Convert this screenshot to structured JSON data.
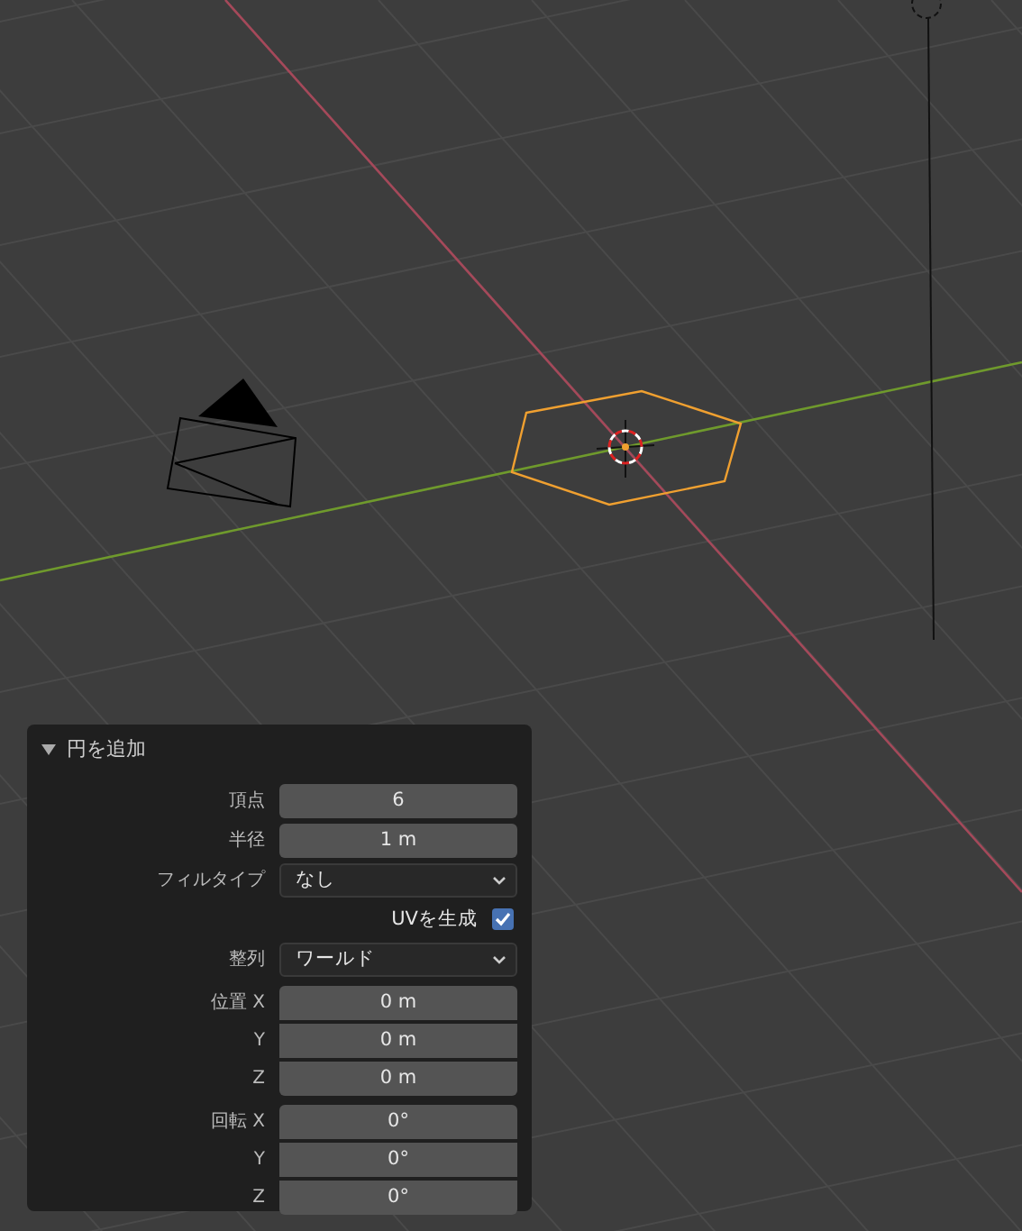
{
  "panel": {
    "title": "円を追加",
    "expanded": true,
    "rows": [
      {
        "kind": "number",
        "label": "頂点",
        "value": "6"
      },
      {
        "kind": "number",
        "label": "半径",
        "value": "1 m"
      },
      {
        "kind": "dropdown",
        "label": "フィルタイプ",
        "value": "なし"
      },
      {
        "kind": "checkbox",
        "label": "UVを生成",
        "checked": true
      },
      {
        "kind": "dropdown",
        "label": "整列",
        "value": "ワールド"
      },
      {
        "kind": "vector",
        "items": [
          {
            "label": "位置 X",
            "value": "0 m"
          },
          {
            "label": "Y",
            "value": "0 m"
          },
          {
            "label": "Z",
            "value": "0 m"
          }
        ]
      },
      {
        "kind": "vector",
        "items": [
          {
            "label": "回転 X",
            "value": "0°"
          },
          {
            "label": "Y",
            "value": "0°"
          },
          {
            "label": "Z",
            "value": "0°"
          }
        ]
      }
    ]
  }
}
